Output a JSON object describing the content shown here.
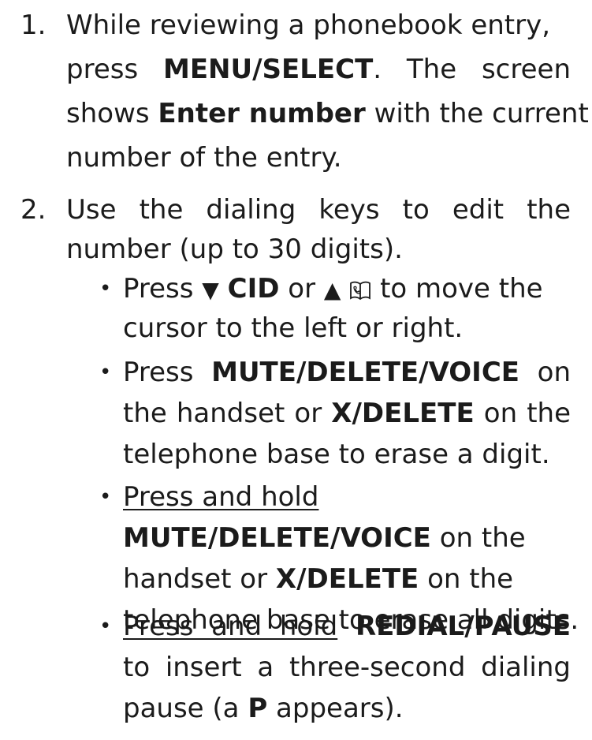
{
  "steps": [
    {
      "number": "1.",
      "lines": [
        {
          "pre": "While reviewing a phonebook entry,"
        },
        {
          "pre": "press ",
          "bold": "MENU/SELECT",
          "post": ". The screen"
        },
        {
          "pre": "shows ",
          "bold": "Enter number",
          "post": " with the current"
        },
        {
          "pre": "number of the entry."
        }
      ]
    },
    {
      "number": "2.",
      "lines": [
        {
          "pre": "Use the dialing keys to edit the"
        },
        {
          "pre": "number (up to 30 digits)."
        }
      ],
      "bullets": [
        {
          "l1_press": "Press",
          "l1_cid": "CID",
          "l1_or": "or",
          "l1_post": "to move the",
          "l2": "cursor to the left or right."
        },
        {
          "l1_pre": "Press ",
          "l1_bold": "MUTE/DELETE/VOICE",
          "l1_post": " on",
          "l2_pre": "the handset or ",
          "l2_bold": "X/DELETE",
          "l2_post": " on the",
          "l3": "telephone base to erase a digit."
        },
        {
          "l1_u": "Press and hold",
          "l2_bold": "MUTE/DELETE/VOICE",
          "l2_post": " on the",
          "l3_pre": "handset or ",
          "l3_bold": "X/DELETE",
          "l3_post": " on the",
          "l4": "telephone base to erase all digits."
        },
        {
          "l1_u": "Press and hold",
          "l1_bold": "REDIAL/PAUSE",
          "l2": "to insert a three-second dialing",
          "l3_pre": "pause (a ",
          "l3_bold": "P",
          "l3_post": " appears)."
        }
      ]
    }
  ],
  "icons": {
    "down_triangle": "▼",
    "up_triangle": "▲",
    "bullet": "•",
    "phonebook_icon": "book-icon"
  }
}
